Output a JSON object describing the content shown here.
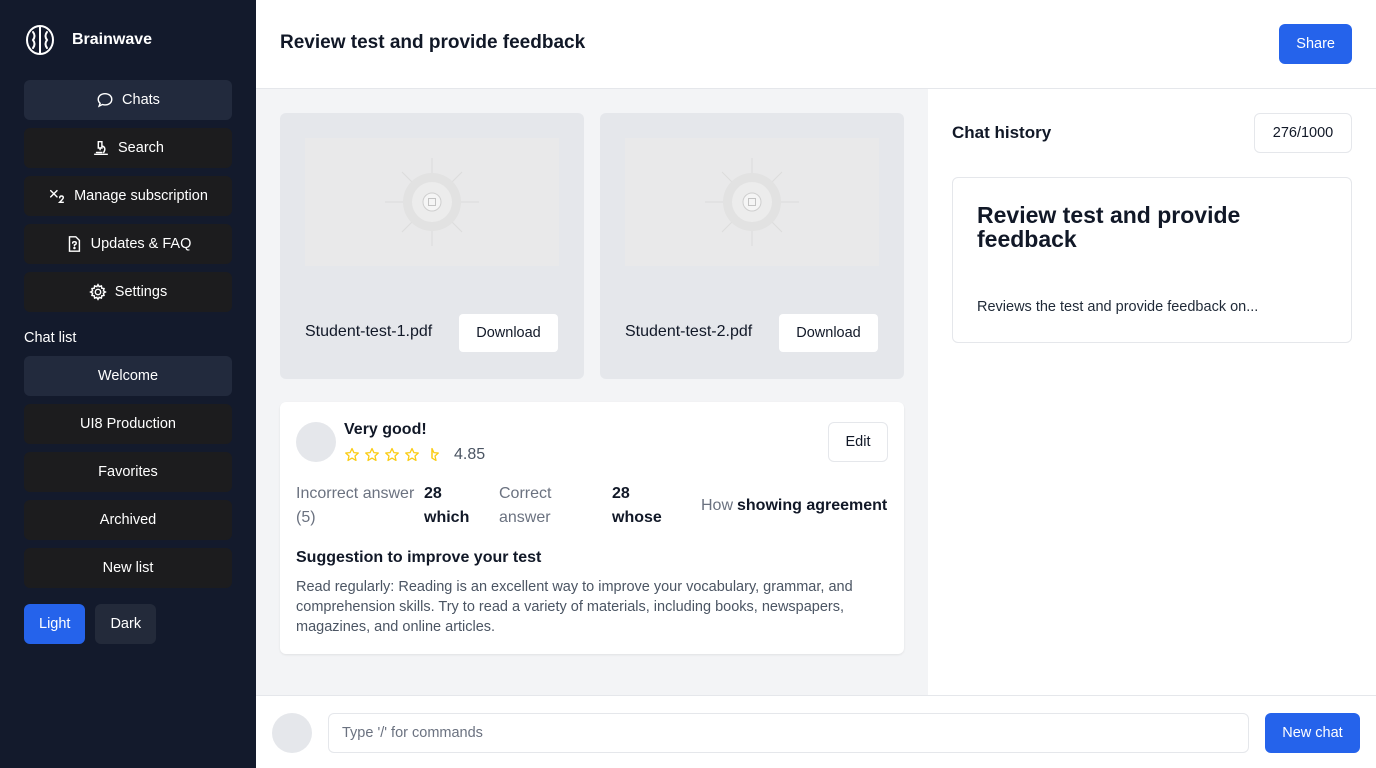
{
  "app": {
    "name": "Brainwave"
  },
  "sidebar": {
    "nav": [
      {
        "label": "Chats",
        "icon": "chat-bubble-icon"
      },
      {
        "label": "Search",
        "icon": "microscope-icon"
      },
      {
        "label": "Manage subscription",
        "icon": "subscript-icon"
      },
      {
        "label": "Updates & FAQ",
        "icon": "file-question-icon"
      },
      {
        "label": "Settings",
        "icon": "gear-icon"
      }
    ],
    "chat_list_title": "Chat list",
    "chat_list": [
      {
        "label": "Welcome"
      },
      {
        "label": "UI8 Production"
      },
      {
        "label": "Favorites"
      },
      {
        "label": "Archived"
      },
      {
        "label": "New list"
      }
    ],
    "theme": {
      "light": "Light",
      "dark": "Dark",
      "selected": "Light"
    }
  },
  "header": {
    "title": "Review test and provide feedback",
    "share_label": "Share"
  },
  "files": [
    {
      "name": "Student-test-1.pdf",
      "download_label": "Download"
    },
    {
      "name": "Student-test-2.pdf",
      "download_label": "Download"
    }
  ],
  "feedback": {
    "title": "Very good!",
    "rating": "4.85",
    "stars_filled_fraction": 0.9,
    "edit_label": "Edit",
    "stats": [
      {
        "label": "Incorrect answer (5)",
        "value": "28 which"
      },
      {
        "label": "Correct answer",
        "value": "28 whose"
      },
      {
        "label": "How",
        "value": "showing agreement"
      }
    ],
    "suggestion_title": "Suggestion to improve your test",
    "suggestion_text": "Read regularly: Reading is an excellent way to improve your vocabulary, grammar, and comprehension skills. Try to read a variety of materials, including books, newspapers, magazines, and online articles."
  },
  "history": {
    "title": "Chat history",
    "count": "276/1000",
    "card": {
      "title": "Review test and provide feedback",
      "description": "Reviews the test and provide feedback on..."
    }
  },
  "composer": {
    "placeholder": "Type '/' for commands",
    "new_chat_label": "New chat"
  },
  "colors": {
    "accent": "#2563eb",
    "sidebar_bg": "#131a2c",
    "star": "#facc15"
  }
}
